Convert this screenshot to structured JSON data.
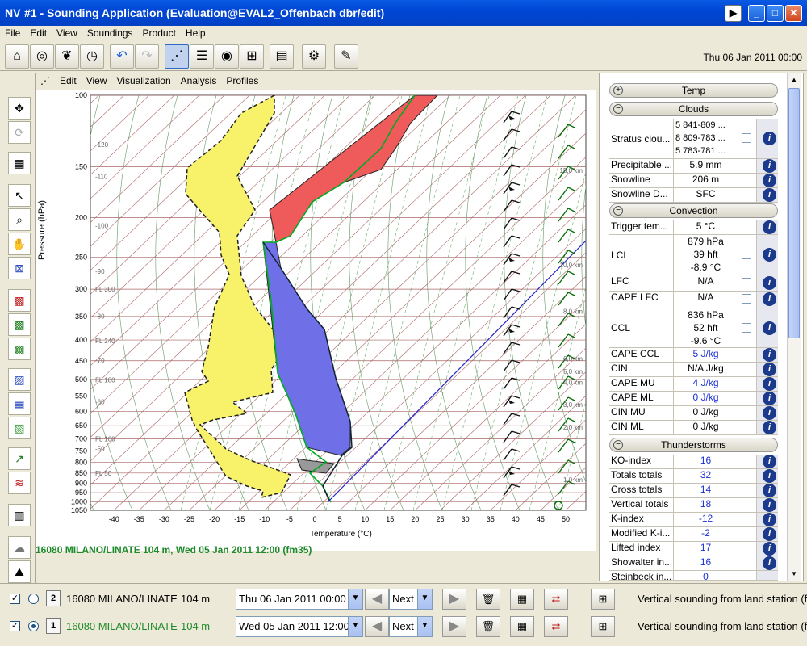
{
  "window": {
    "title": "#1 - Sounding Application (Evaluation@EVAL2_Offenbach dbr/edit)",
    "icon": "NV"
  },
  "menu": [
    "File",
    "Edit",
    "View",
    "Soundings",
    "Product",
    "Help"
  ],
  "toolbar": {
    "date": "Thu 06 Jan 2011 00:00"
  },
  "submenu": [
    "Edit",
    "View",
    "Visualization",
    "Analysis",
    "Profiles"
  ],
  "chart": {
    "ylabel": "Pressure (hPa)",
    "xlabel": "Temperature (°C)"
  },
  "chart_data": {
    "type": "line",
    "xlabel": "Temperature (°C)",
    "ylabel": "Pressure (hPa)",
    "xlim": [
      -45,
      50
    ],
    "ylim": [
      1050,
      100
    ],
    "x_ticks": [
      "-40",
      "-35",
      "-30",
      "-25",
      "-20",
      "-15",
      "-10",
      "-5",
      "0",
      "5",
      "10",
      "15",
      "20",
      "25",
      "30",
      "35",
      "40",
      "45",
      "50"
    ],
    "y_ticks": [
      "100",
      "150",
      "200",
      "250",
      "300",
      "350",
      "400",
      "450",
      "500",
      "550",
      "600",
      "650",
      "700",
      "750",
      "800",
      "850",
      "900",
      "950",
      "1000",
      "1050"
    ],
    "height_labels": [
      "-120",
      "-110",
      "-100",
      "-90",
      "-80",
      "-70",
      "-60",
      "-50",
      "FL 300",
      "FL 240",
      "FL 180",
      "FL 100",
      "FL 50"
    ],
    "km_labels": [
      "15,0 km",
      "10,0 km",
      "8,0 km",
      "6,0 km",
      "5,0 km",
      "4,0 km",
      "3,0 km",
      "2,0 km",
      "1,0 km"
    ],
    "grid": true
  },
  "station_header": "16080 MILANO/LINATE 104 m, Wed 05 Jan 2011 12:00 (fm35)",
  "panel": {
    "temp": "Temp",
    "clouds": "Clouds",
    "stratus": {
      "label": "Stratus clou...",
      "values": [
        "5  841-809 ...",
        "8  809-783 ...",
        "5  783-781 ..."
      ]
    },
    "precip": {
      "label": "Precipitable ...",
      "value": "5.9 mm"
    },
    "snowline": {
      "label": "Snowline",
      "value": "206 m"
    },
    "snowline_d": {
      "label": "Snowline D...",
      "value": "SFC"
    },
    "convection": "Convection",
    "trigger": {
      "label": "Trigger tem...",
      "value": "5 °C"
    },
    "lcl": {
      "label": "LCL",
      "values": [
        "879 hPa",
        "39 hft",
        "-8.9 °C"
      ]
    },
    "lfc": {
      "label": "LFC",
      "value": "N/A"
    },
    "cape_lfc": {
      "label": "CAPE LFC",
      "value": "N/A"
    },
    "ccl": {
      "label": "CCL",
      "values": [
        "836 hPa",
        "52 hft",
        "-9.6 °C"
      ]
    },
    "cape_ccl": {
      "label": "CAPE CCL",
      "value": "5 J/kg"
    },
    "cin": {
      "label": "CIN",
      "value": "N/A J/kg"
    },
    "cape_mu": {
      "label": "CAPE MU",
      "value": "4 J/kg"
    },
    "cape_ml": {
      "label": "CAPE ML",
      "value": "0 J/kg"
    },
    "cin_mu": {
      "label": "CIN MU",
      "value": "0 J/kg"
    },
    "cin_ml": {
      "label": "CIN ML",
      "value": "0 J/kg"
    },
    "thunder": "Thunderstorms",
    "ko": {
      "label": "KO-index",
      "value": "16"
    },
    "totals": {
      "label": "Totals totals",
      "value": "32"
    },
    "cross": {
      "label": "Cross totals",
      "value": "14"
    },
    "vertical": {
      "label": "Vertical totals",
      "value": "18"
    },
    "kindex": {
      "label": "K-index",
      "value": "-12"
    },
    "modk": {
      "label": "Modified K-i...",
      "value": "-2"
    },
    "lifted": {
      "label": "Lifted index",
      "value": "17"
    },
    "showalter": {
      "label": "Showalter in...",
      "value": "16"
    },
    "steinbeck": {
      "label": "Steinbeck in...",
      "value": "0"
    }
  },
  "rows": [
    {
      "num": "2",
      "station": "16080 MILANO/LINATE",
      "elev": "104 m",
      "date": "Thu 06 Jan 2011 00:00",
      "next": "Next",
      "desc": "Vertical sounding from land station (fr"
    },
    {
      "num": "1",
      "station": "16080 MILANO/LINATE",
      "elev": "104 m",
      "date": "Wed 05 Jan 2011 12:00",
      "next": "Next",
      "desc": "Vertical sounding from land station (fr"
    }
  ]
}
